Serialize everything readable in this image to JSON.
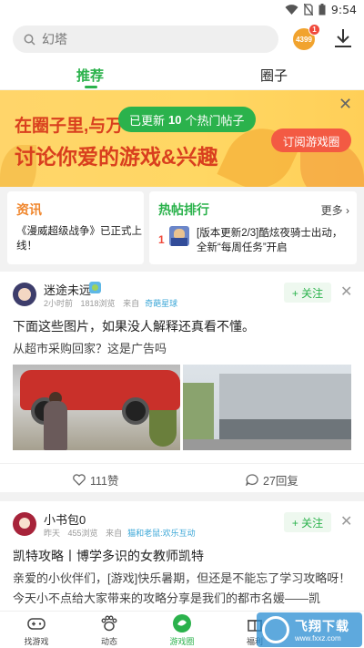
{
  "status_bar": {
    "time": "9:54"
  },
  "search": {
    "placeholder": "幻塔"
  },
  "header": {
    "app_badge_label": "4399",
    "app_badge_count": "1"
  },
  "tabs": [
    {
      "label": "推荐",
      "active": true
    },
    {
      "label": "圈子",
      "active": false
    }
  ],
  "banner": {
    "line1": "在圈子里,与万",
    "line2": "讨论你爱的游戏&兴趣",
    "pill_prefix": "已更新",
    "pill_count": "10",
    "pill_suffix": "个热门帖子",
    "subscribe_button": "订阅游戏圈"
  },
  "news_card": {
    "title": "资讯",
    "item": "《漫威超级战争》已正式上线！"
  },
  "hot_card": {
    "title": "热帖排行",
    "more_label": "更多",
    "rank": "1",
    "item": "[版本更新2/3]酷炫夜骑士出动，全新“每周任务”开启"
  },
  "posts": [
    {
      "username": "迷途未远",
      "time": "2小时前",
      "views": "1818浏览",
      "source_prefix": "来自",
      "source": "奇葩星球",
      "follow_label": "+ 关注",
      "title": "下面这些图片，如果没人解释还真看不懂。",
      "body": "从超市采购回家？这是广告吗",
      "likes": "111赞",
      "replies": "27回复"
    },
    {
      "username": "小书包0",
      "time": "昨天",
      "views": "455浏览",
      "source_prefix": "来自",
      "source": "猫和老鼠:欢乐互动",
      "follow_label": "+ 关注",
      "title": "凯特攻略丨博学多识的女教师凯特",
      "body": "亲爱的小伙伴们，[游戏]快乐暑期，但还是不能忘了学习攻略呀！今天小不点给大家带来的攻略分享是我们的都市名媛——凯"
    }
  ],
  "bottom_nav": [
    {
      "label": "找游戏",
      "icon": "gamepad-icon"
    },
    {
      "label": "动态",
      "icon": "paw-icon"
    },
    {
      "label": "游戏圈",
      "icon": "circle-icon",
      "active": true
    },
    {
      "label": "福利",
      "icon": "gift-icon"
    }
  ],
  "watermark": {
    "title": "飞翔下载",
    "url": "www.fxxz.com"
  },
  "colors": {
    "accent": "#2bb24c",
    "banner_text": "#d93f1e",
    "subscribe": "#f35a43",
    "news": "#f0862c"
  }
}
